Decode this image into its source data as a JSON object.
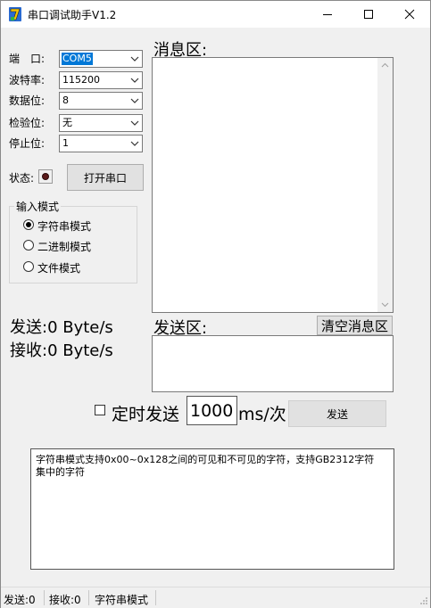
{
  "window": {
    "title": "串口调试助手V1.2"
  },
  "settings": {
    "port_label": "端　口:",
    "port_value": "COM5",
    "baud_label": "波特率:",
    "baud_value": "115200",
    "databits_label": "数据位:",
    "databits_value": "8",
    "parity_label": "检验位:",
    "parity_value": "无",
    "stopbits_label": "停止位:",
    "stopbits_value": "1"
  },
  "status": {
    "label": "状态:",
    "open_button": "打开串口"
  },
  "mode_group": {
    "title": "输入模式",
    "options": [
      "字符串模式",
      "二进制模式",
      "文件模式"
    ],
    "selected": "字符串模式"
  },
  "message_area": {
    "label": "消息区:",
    "clear_button": "清空消息区"
  },
  "send_area": {
    "label": "发送区:"
  },
  "rates": {
    "send": "发送:0 Byte/s",
    "receive": "接收:0 Byte/s"
  },
  "timer": {
    "checkbox_label": "定时发送",
    "interval_value": "1000",
    "unit": "ms/次",
    "send_button": "发送"
  },
  "info": {
    "text": "字符串模式支持0x00~0x128之间的可见和不可见的字符，支持GB2312字符集中的字符"
  },
  "statusbar": {
    "sent": "发送:0",
    "received": "接收:0",
    "mode": "字符串模式"
  },
  "colors": {
    "window_bg": "#f0f0f0",
    "selection": "#0078d7",
    "button_bg": "#e1e1e1"
  }
}
